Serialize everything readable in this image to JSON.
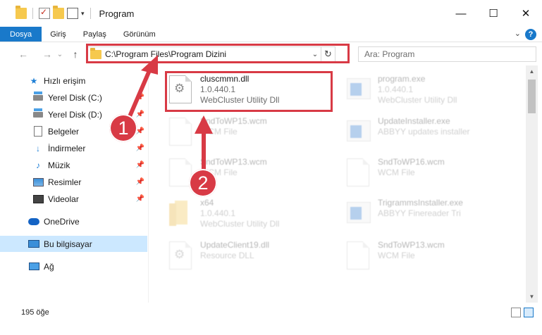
{
  "window": {
    "title": "Program",
    "controls": {
      "minimize": "—",
      "maximize": "☐",
      "close": "✕"
    }
  },
  "qat": {
    "dropdown": "▾"
  },
  "ribbon": {
    "tabs": [
      "Dosya",
      "Giriş",
      "Paylaş",
      "Görünüm"
    ],
    "help": "?",
    "collapse": "⌄"
  },
  "nav": {
    "back": "←",
    "forward": "→",
    "recent": "⌄",
    "up": "↑",
    "address": "C:\\Program Files\\Program Dizini",
    "address_dropdown": "⌄",
    "refresh": "↻",
    "search_placeholder": "Ara: Program"
  },
  "sidebar": {
    "items": [
      {
        "label": "Hızlı erişim",
        "icon": "star-icon",
        "pinned": false
      },
      {
        "label": "Yerel Disk (C:)",
        "icon": "drive-icon",
        "pinned": true
      },
      {
        "label": "Yerel Disk (D:)",
        "icon": "drive-icon",
        "pinned": true
      },
      {
        "label": "Belgeler",
        "icon": "documents-icon",
        "pinned": true
      },
      {
        "label": "İndirmeler",
        "icon": "downloads-icon",
        "pinned": true
      },
      {
        "label": "Müzik",
        "icon": "music-icon",
        "pinned": true
      },
      {
        "label": "Resimler",
        "icon": "pictures-icon",
        "pinned": true
      },
      {
        "label": "Videolar",
        "icon": "videos-icon",
        "pinned": true
      },
      {
        "label": "OneDrive",
        "icon": "onedrive-icon",
        "pinned": false
      },
      {
        "label": "Bu bilgisayar",
        "icon": "this-pc-icon",
        "pinned": false,
        "selected": true
      },
      {
        "label": "Ağ",
        "icon": "network-icon",
        "pinned": false
      }
    ],
    "pin_glyph": "📌"
  },
  "files": [
    {
      "name": "cluscmmn.dll",
      "line2": "1.0.440.1",
      "line3": "WebCluster Utility Dll",
      "icon": "dll-gear-icon",
      "highlighted": true
    },
    {
      "name": "program.exe",
      "line2": "1.0.440.1",
      "line3": "WebCluster Utility Dll",
      "icon": "exe-icon"
    },
    {
      "name": "SndToWP15.wcm",
      "line2": "WCM File",
      "line3": "",
      "icon": "file-icon"
    },
    {
      "name": "UpdateInstaller.exe",
      "line2": "ABBYY updates installer",
      "line3": "",
      "icon": "exe-icon"
    },
    {
      "name": "SndToWP13.wcm",
      "line2": "WCM File",
      "line3": "",
      "icon": "file-icon"
    },
    {
      "name": "SndToWP16.wcm",
      "line2": "WCM File",
      "line3": "",
      "icon": "file-icon"
    },
    {
      "name": "x64",
      "line2": "1.0.440.1",
      "line3": "WebCluster Utility Dll",
      "icon": "folder-icon"
    },
    {
      "name": "TrigrammsInstaller.exe",
      "line2": "ABBYY Finereader Tri",
      "line3": "",
      "icon": "exe-icon"
    },
    {
      "name": "UpdateClient19.dll",
      "line2": "Resource DLL",
      "line3": "",
      "icon": "dll-gear-icon"
    },
    {
      "name": "SndToWP13.wcm",
      "line2": "WCM File",
      "line3": "",
      "icon": "file-icon"
    }
  ],
  "status": {
    "item_count": "195 öğe"
  },
  "scrollbar": {
    "up": "▲",
    "down": "▼"
  },
  "callouts": {
    "one": "1",
    "two": "2"
  },
  "colors": {
    "accent": "#1979ca",
    "highlight": "#d83a45",
    "selected": "#cce8ff"
  }
}
